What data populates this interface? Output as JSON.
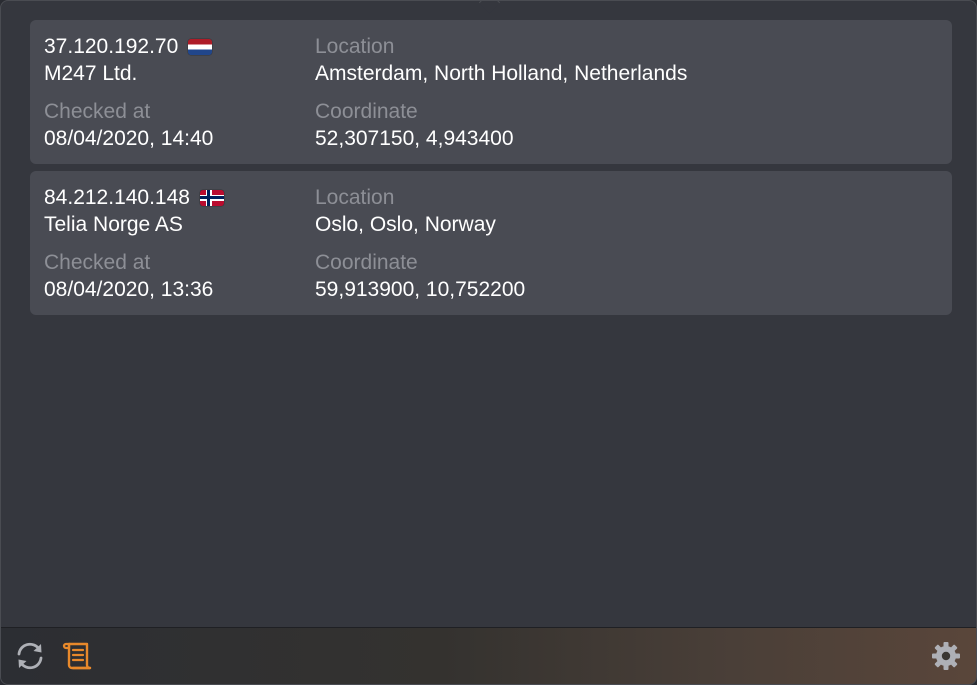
{
  "records": [
    {
      "ip": "37.120.192.70",
      "flag": "netherlands-flag-icon",
      "isp": "M247 Ltd.",
      "location_label": "Location",
      "location": "Amsterdam, North Holland, Netherlands",
      "checked_label": "Checked at",
      "checked_at": "08/04/2020, 14:40",
      "coordinate_label": "Coordinate",
      "coordinate": "52,307150, 4,943400"
    },
    {
      "ip": "84.212.140.148",
      "flag": "norway-flag-icon",
      "isp": "Telia Norge AS",
      "location_label": "Location",
      "location": "Oslo, Oslo, Norway",
      "checked_label": "Checked at",
      "checked_at": "08/04/2020, 13:36",
      "coordinate_label": "Coordinate",
      "coordinate": "59,913900, 10,752200"
    }
  ],
  "footer": {
    "refresh_icon": "refresh-icon",
    "log_icon": "scroll-log-icon",
    "settings_icon": "gear-icon"
  },
  "colors": {
    "background": "#35373e",
    "card": "#494b53",
    "label": "#8d8f96",
    "value": "#ffffff",
    "accent_orange": "#e8892b",
    "icon_gray": "#aeb0b6"
  }
}
